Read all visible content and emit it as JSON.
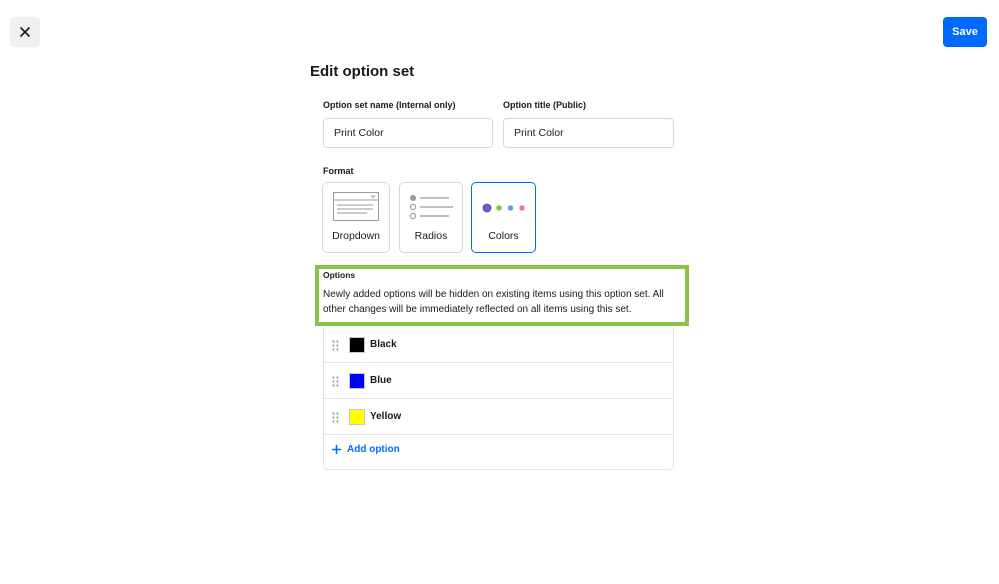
{
  "header": {
    "save_label": "Save",
    "title": "Edit option set"
  },
  "fields": {
    "name_label": "Option set name (Internal only)",
    "name_value": "Print Color",
    "title_label": "Option title (Public)",
    "title_value": "Print Color"
  },
  "format": {
    "label": "Format",
    "cards": [
      {
        "label": "Dropdown",
        "icon": "dropdown-icon",
        "selected": false
      },
      {
        "label": "Radios",
        "icon": "radios-icon",
        "selected": false
      },
      {
        "label": "Colors",
        "icon": "colors-icon",
        "selected": true
      }
    ]
  },
  "options": {
    "label": "Options",
    "description": "Newly added options will be hidden on existing items using this option set. All other changes will be immediately reflected on all items using this set.",
    "items": [
      {
        "name": "Black",
        "color": "#000000"
      },
      {
        "name": "Blue",
        "color": "#0000ff"
      },
      {
        "name": "Yellow",
        "color": "#ffff00"
      }
    ],
    "add_label": "Add option"
  },
  "colors": {
    "accent": "#006aff",
    "highlight": "#8bc34a",
    "dot_purple": "#7b5cc4",
    "dot_green": "#7cc24a",
    "dot_blue": "#6b8ff5",
    "dot_pink": "#f07a8a"
  }
}
